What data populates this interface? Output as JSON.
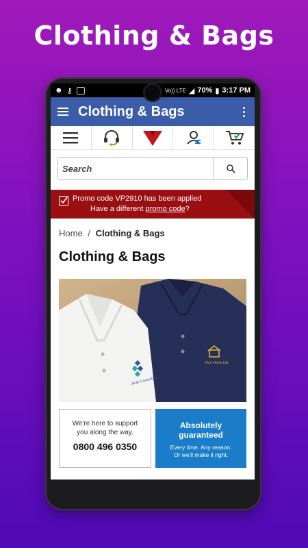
{
  "banner": {
    "title": "Clothing & Bags"
  },
  "status_bar": {
    "network": "Vo)) LTE",
    "lte": "LTE",
    "battery": "70%",
    "time": "3:17 PM"
  },
  "app_bar": {
    "title": "Clothing & Bags"
  },
  "icon_row": [
    "menu-icon",
    "headset-icon",
    "brand-logo-icon",
    "account-icon",
    "cart-icon"
  ],
  "search": {
    "placeholder": "Search"
  },
  "promo": {
    "line1": "Promo code VP2910 has been applied",
    "line2_prefix": "Have a different ",
    "line2_link": "promo code",
    "line2_suffix": "?"
  },
  "breadcrumb": {
    "home": "Home",
    "separator": "/",
    "current": "Clothing & Bags"
  },
  "page": {
    "title": "Clothing & Bags"
  },
  "hero": {
    "white_shirt_logo": "Jedo Consulting",
    "navy_shirt_logo": "First Home Ltd."
  },
  "support_card": {
    "line1": "We're here to support",
    "line2": "you along the way.",
    "phone": "0800 496 0350"
  },
  "guarantee_card": {
    "title1": "Absolutely",
    "title2": "guaranteed",
    "sub1": "Every time. Any reason.",
    "sub2": "Or we'll make it right."
  },
  "colors": {
    "background_top": "#a019b9",
    "background_bottom": "#4f0ab6",
    "app_bar": "#3b5ca9",
    "promo": "#9b0f12",
    "guarantee": "#1b7dc9"
  }
}
